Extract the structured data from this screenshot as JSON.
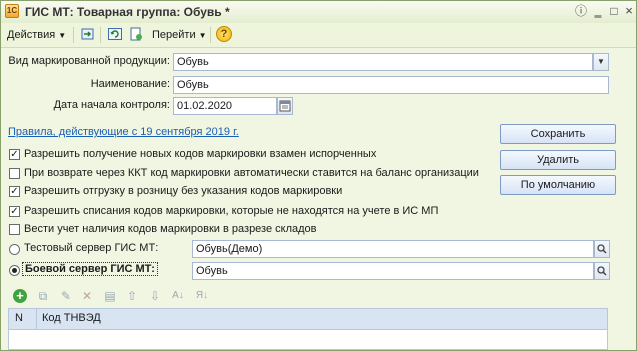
{
  "window": {
    "title": "ГИС МТ: Товарная группа: Обувь *"
  },
  "toolbar": {
    "actions_label": "Действия",
    "goto_label": "Перейти"
  },
  "form": {
    "product_type_label": "Вид маркированной продукции:",
    "product_type_value": "Обувь",
    "name_label": "Наименование:",
    "name_value": "Обувь",
    "control_date_label": "Дата начала контроля:",
    "control_date_value": "01.02.2020",
    "rules_link": "Правила, действующие с 19 сентября 2019 г."
  },
  "buttons": {
    "save": "Сохранить",
    "delete": "Удалить",
    "default": "По умолчанию"
  },
  "options": [
    {
      "label": "Разрешить получение новых кодов маркировки взамен испорченных",
      "checked": true
    },
    {
      "label": "При возврате через ККТ код маркировки автоматически ставится на баланс организации",
      "checked": false
    },
    {
      "label": "Разрешить отгрузку в розницу без указания кодов маркировки",
      "checked": true
    },
    {
      "label": "Разрешить списания кодов маркировки, которые не находятся на учете в ИС МП",
      "checked": true
    },
    {
      "label": "Вести учет наличия кодов маркировки в разрезе складов",
      "checked": false
    }
  ],
  "servers": {
    "test_label": "Тестовый сервер ГИС МТ:",
    "test_value": "Обувь(Демо)",
    "prod_label": "Боевой сервер ГИС МТ:",
    "prod_value": "Обувь",
    "selected": "prod"
  },
  "table": {
    "columns": [
      "N",
      "Код ТНВЭД"
    ]
  }
}
